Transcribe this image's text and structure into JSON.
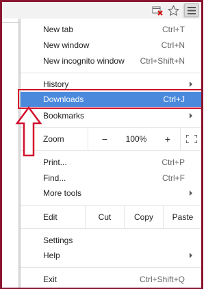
{
  "toolbar": {
    "page_action_icon": "page-blocked-icon",
    "bookmark_icon": "star-icon",
    "menu_icon": "hamburger-menu-icon"
  },
  "menu": {
    "new_tab": {
      "label": "New tab",
      "shortcut": "Ctrl+T"
    },
    "new_window": {
      "label": "New window",
      "shortcut": "Ctrl+N"
    },
    "new_incognito": {
      "label": "New incognito window",
      "shortcut": "Ctrl+Shift+N"
    },
    "history": {
      "label": "History"
    },
    "downloads": {
      "label": "Downloads",
      "shortcut": "Ctrl+J"
    },
    "bookmarks": {
      "label": "Bookmarks"
    },
    "zoom": {
      "label": "Zoom",
      "minus": "−",
      "level": "100%",
      "plus": "+"
    },
    "print": {
      "label": "Print...",
      "shortcut": "Ctrl+P"
    },
    "find": {
      "label": "Find...",
      "shortcut": "Ctrl+F"
    },
    "more_tools": {
      "label": "More tools"
    },
    "edit": {
      "label": "Edit",
      "cut": "Cut",
      "copy": "Copy",
      "paste": "Paste"
    },
    "settings": {
      "label": "Settings"
    },
    "help": {
      "label": "Help"
    },
    "exit": {
      "label": "Exit",
      "shortcut": "Ctrl+Shift+Q"
    }
  },
  "colors": {
    "frame": "#8a1530",
    "highlight_bg": "#4a89dc",
    "annotation_red": "#d1102e"
  }
}
